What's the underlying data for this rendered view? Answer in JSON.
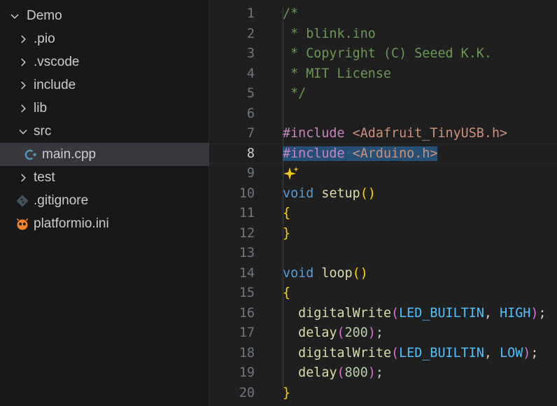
{
  "explorer": {
    "items": [
      {
        "label": "Demo",
        "chevron": "chevron-down-icon",
        "icon": ""
      },
      {
        "label": ".pio",
        "chevron": "chevron-right-icon",
        "icon": ""
      },
      {
        "label": ".vscode",
        "chevron": "chevron-right-icon",
        "icon": ""
      },
      {
        "label": "include",
        "chevron": "chevron-right-icon",
        "icon": ""
      },
      {
        "label": "lib",
        "chevron": "chevron-right-icon",
        "icon": ""
      },
      {
        "label": "src",
        "chevron": "chevron-down-icon",
        "icon": ""
      },
      {
        "label": "main.cpp",
        "chevron": "",
        "icon": "cpp-file-icon",
        "selected": true
      },
      {
        "label": "test",
        "chevron": "chevron-right-icon",
        "icon": ""
      },
      {
        "label": ".gitignore",
        "chevron": "",
        "icon": "git-file-icon"
      },
      {
        "label": "platformio.ini",
        "chevron": "",
        "icon": "platformio-icon"
      }
    ]
  },
  "editor": {
    "active_line": 8,
    "lines": [
      {
        "n": "1",
        "t": [
          [
            "cm",
            "/*"
          ]
        ]
      },
      {
        "n": "2",
        "t": [
          [
            "cm",
            " * blink.ino"
          ]
        ]
      },
      {
        "n": "3",
        "t": [
          [
            "cm",
            " * Copyright (C) Seeed K.K."
          ]
        ]
      },
      {
        "n": "4",
        "t": [
          [
            "cm",
            " * MIT License"
          ]
        ]
      },
      {
        "n": "5",
        "t": [
          [
            "cm",
            " */"
          ]
        ]
      },
      {
        "n": "6",
        "t": []
      },
      {
        "n": "7",
        "t": [
          [
            "pp",
            "#include"
          ],
          [
            "pn",
            " "
          ],
          [
            "str",
            "<Adafruit_TinyUSB.h>"
          ]
        ]
      },
      {
        "n": "8",
        "t": [
          [
            "pp sel",
            "#include"
          ],
          [
            "ws sel",
            "·"
          ],
          [
            "str sel",
            "<Arduino.h>"
          ]
        ]
      },
      {
        "n": "9",
        "t": [
          [
            "icon",
            "sparkle-icon"
          ]
        ]
      },
      {
        "n": "10",
        "t": [
          [
            "kw",
            "void"
          ],
          [
            "pn",
            " "
          ],
          [
            "fn",
            "setup"
          ],
          [
            "b1",
            "()"
          ]
        ]
      },
      {
        "n": "11",
        "t": [
          [
            "b1",
            "{"
          ]
        ]
      },
      {
        "n": "12",
        "t": [
          [
            "b1",
            "}"
          ]
        ]
      },
      {
        "n": "13",
        "t": []
      },
      {
        "n": "14",
        "t": [
          [
            "kw",
            "void"
          ],
          [
            "pn",
            " "
          ],
          [
            "fn",
            "loop"
          ],
          [
            "b1",
            "()"
          ]
        ]
      },
      {
        "n": "15",
        "t": [
          [
            "b1",
            "{"
          ]
        ]
      },
      {
        "n": "16",
        "t": [
          [
            "pn",
            "  "
          ],
          [
            "fn",
            "digitalWrite"
          ],
          [
            "b2",
            "("
          ],
          [
            "cst",
            "LED_BUILTIN"
          ],
          [
            "pn",
            ", "
          ],
          [
            "cst",
            "HIGH"
          ],
          [
            "b2",
            ")"
          ],
          [
            "pn",
            ";"
          ]
        ]
      },
      {
        "n": "17",
        "t": [
          [
            "pn",
            "  "
          ],
          [
            "fn",
            "delay"
          ],
          [
            "b2",
            "("
          ],
          [
            "num",
            "200"
          ],
          [
            "b2",
            ")"
          ],
          [
            "pn",
            ";"
          ]
        ]
      },
      {
        "n": "18",
        "t": [
          [
            "pn",
            "  "
          ],
          [
            "fn",
            "digitalWrite"
          ],
          [
            "b2",
            "("
          ],
          [
            "cst",
            "LED_BUILTIN"
          ],
          [
            "pn",
            ", "
          ],
          [
            "cst",
            "LOW"
          ],
          [
            "b2",
            ")"
          ],
          [
            "pn",
            ";"
          ]
        ]
      },
      {
        "n": "19",
        "t": [
          [
            "pn",
            "  "
          ],
          [
            "fn",
            "delay"
          ],
          [
            "b2",
            "("
          ],
          [
            "num",
            "800"
          ],
          [
            "b2",
            ")"
          ],
          [
            "pn",
            ";"
          ]
        ]
      },
      {
        "n": "20",
        "t": [
          [
            "b1",
            "}"
          ]
        ]
      }
    ]
  }
}
